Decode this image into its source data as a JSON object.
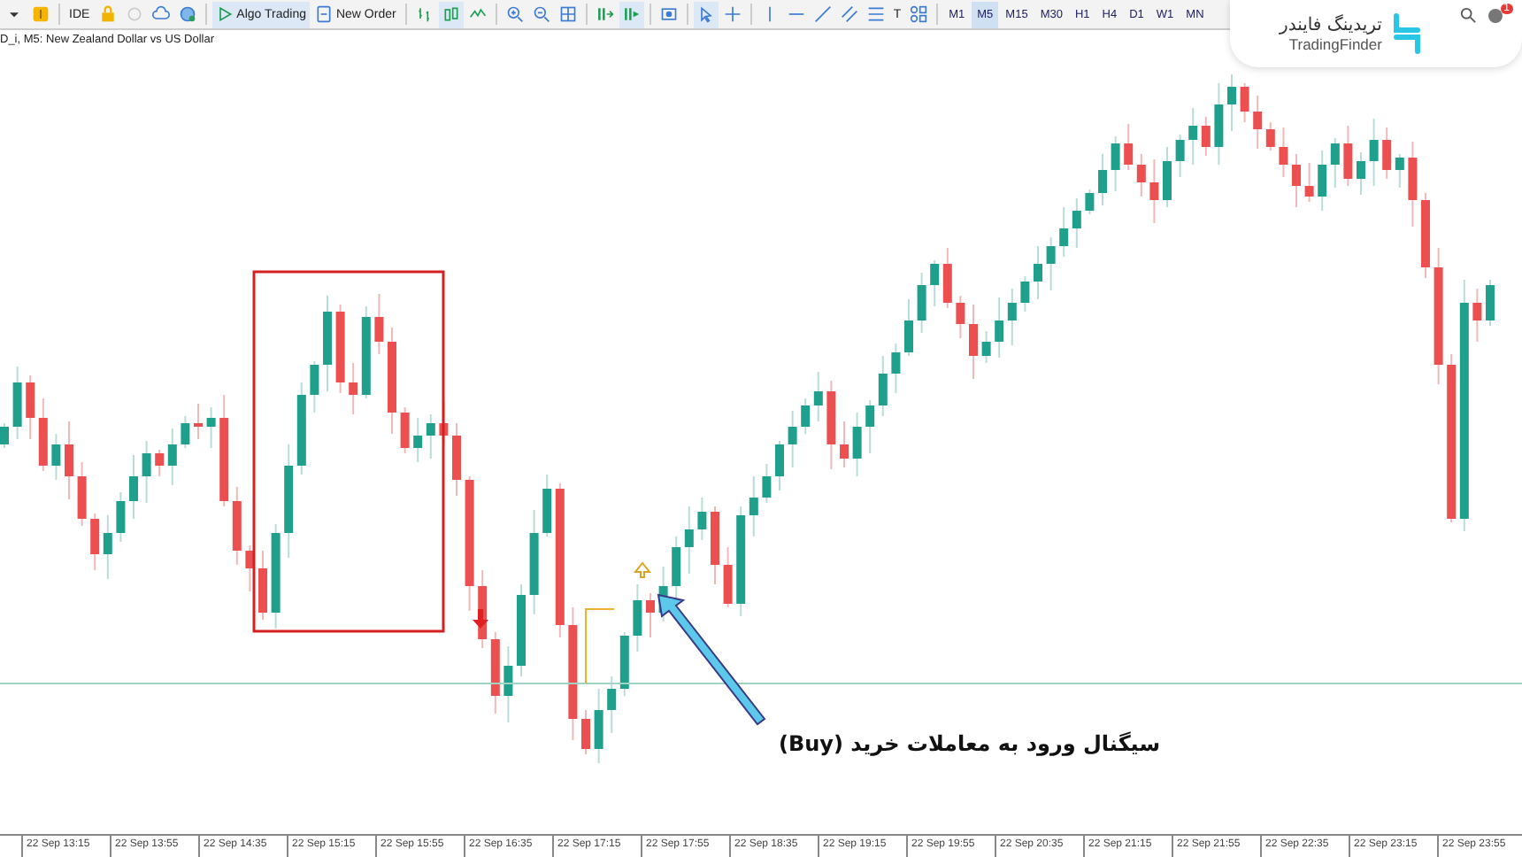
{
  "toolbar": {
    "items": [
      {
        "kind": "caret",
        "selected": false
      },
      {
        "kind": "coin",
        "selected": false
      },
      {
        "kind": "sep"
      },
      {
        "kind": "text",
        "label": "IDE",
        "selected": false
      },
      {
        "kind": "lock",
        "selected": false
      },
      {
        "kind": "blocked",
        "selected": false
      },
      {
        "kind": "cloud",
        "selected": false
      },
      {
        "kind": "globe",
        "selected": false
      },
      {
        "kind": "sep"
      },
      {
        "kind": "play",
        "label": "Algo Trading",
        "selected": true
      },
      {
        "kind": "order",
        "label": "New Order",
        "selected": false
      },
      {
        "kind": "sep"
      },
      {
        "kind": "bars",
        "selected": false
      },
      {
        "kind": "candles",
        "selected": true
      },
      {
        "kind": "line",
        "selected": false
      },
      {
        "kind": "sep"
      },
      {
        "kind": "zoomin",
        "selected": false
      },
      {
        "kind": "zoomout",
        "selected": false
      },
      {
        "kind": "grid",
        "selected": false
      },
      {
        "kind": "sep"
      },
      {
        "kind": "autoscroll",
        "selected": false
      },
      {
        "kind": "shift",
        "selected": true
      },
      {
        "kind": "sep"
      },
      {
        "kind": "screenshot",
        "selected": false
      },
      {
        "kind": "sep"
      },
      {
        "kind": "cursor",
        "selected": true
      },
      {
        "kind": "crosshair",
        "selected": false
      },
      {
        "kind": "sep"
      },
      {
        "kind": "vline",
        "selected": false
      },
      {
        "kind": "hline",
        "selected": false
      },
      {
        "kind": "trend",
        "selected": false
      },
      {
        "kind": "channel",
        "selected": false
      },
      {
        "kind": "fibo",
        "selected": false
      },
      {
        "kind": "text",
        "label": "T",
        "selected": false
      },
      {
        "kind": "shapes",
        "selected": false
      },
      {
        "kind": "sep"
      }
    ],
    "timeframes": [
      {
        "label": "M1",
        "selected": false
      },
      {
        "label": "M5",
        "selected": true
      },
      {
        "label": "M15",
        "selected": false
      },
      {
        "label": "M30",
        "selected": false
      },
      {
        "label": "H1",
        "selected": false
      },
      {
        "label": "H4",
        "selected": false
      },
      {
        "label": "D1",
        "selected": false
      },
      {
        "label": "W1",
        "selected": false
      },
      {
        "label": "MN",
        "selected": false
      }
    ]
  },
  "logo": {
    "name_fa": "تریدینگ فایندر",
    "name_en": "TradingFinder"
  },
  "notifications": {
    "badge": "1"
  },
  "chart": {
    "title": "D_i, M5:  New Zealand Dollar vs US Dollar",
    "annotation": "سیگنال ورود به معاملات خرید (Buy)"
  },
  "time_axis": [
    "22 Sep 13:15",
    "22 Sep 13:55",
    "22 Sep 14:35",
    "22 Sep 15:15",
    "22 Sep 15:55",
    "22 Sep 16:35",
    "22 Sep 17:15",
    "22 Sep 17:55",
    "22 Sep 18:35",
    "22 Sep 19:15",
    "22 Sep 19:55",
    "22 Sep 20:35",
    "22 Sep 21:15",
    "22 Sep 21:55",
    "22 Sep 22:35",
    "22 Sep 23:15",
    "22 Sep 23:55"
  ]
}
